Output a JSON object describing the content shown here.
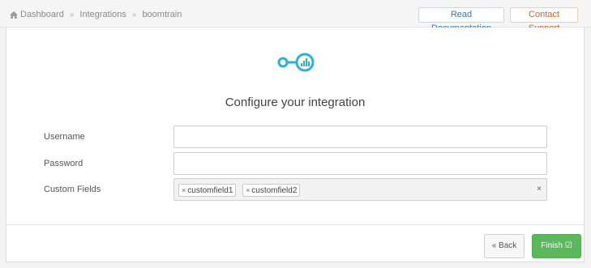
{
  "breadcrumb": {
    "home": "Dashboard",
    "sep1": "»",
    "section": "Integrations",
    "sep2": "»",
    "current": "boomtrain"
  },
  "header": {
    "docs_label": "Read Documentation",
    "support_label": "Contact Support"
  },
  "main": {
    "title": "Configure your integration",
    "username_label": "Username",
    "username_value": "",
    "password_label": "Password",
    "password_value": "",
    "custom_fields_label": "Custom Fields",
    "tags": [
      "customfield1",
      "customfield2"
    ],
    "tag_remove": "×",
    "clear": "×"
  },
  "footer": {
    "back_label": "« Back",
    "finish_label": "Finish ☑"
  },
  "colors": {
    "logo": "#2bb0d6",
    "docs": "#3777bd",
    "support": "#d9602b",
    "finish": "#5cb85c"
  },
  "icons": [
    "home-icon",
    "boomtrain-logo-icon",
    "double-chevron-left-icon",
    "check-square-icon"
  ]
}
